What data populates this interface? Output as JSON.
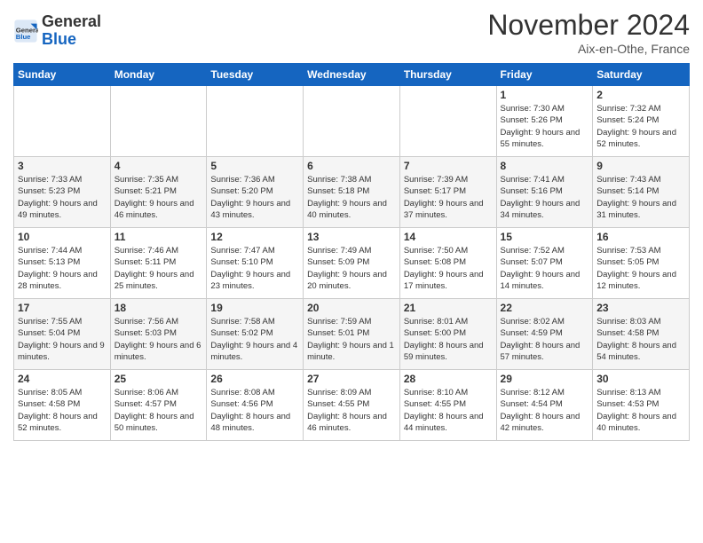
{
  "header": {
    "logo_text_general": "General",
    "logo_text_blue": "Blue",
    "month_title": "November 2024",
    "location": "Aix-en-Othe, France"
  },
  "calendar": {
    "days_of_week": [
      "Sunday",
      "Monday",
      "Tuesday",
      "Wednesday",
      "Thursday",
      "Friday",
      "Saturday"
    ],
    "weeks": [
      [
        {
          "day": "",
          "info": ""
        },
        {
          "day": "",
          "info": ""
        },
        {
          "day": "",
          "info": ""
        },
        {
          "day": "",
          "info": ""
        },
        {
          "day": "",
          "info": ""
        },
        {
          "day": "1",
          "info": "Sunrise: 7:30 AM\nSunset: 5:26 PM\nDaylight: 9 hours and 55 minutes."
        },
        {
          "day": "2",
          "info": "Sunrise: 7:32 AM\nSunset: 5:24 PM\nDaylight: 9 hours and 52 minutes."
        }
      ],
      [
        {
          "day": "3",
          "info": "Sunrise: 7:33 AM\nSunset: 5:23 PM\nDaylight: 9 hours and 49 minutes."
        },
        {
          "day": "4",
          "info": "Sunrise: 7:35 AM\nSunset: 5:21 PM\nDaylight: 9 hours and 46 minutes."
        },
        {
          "day": "5",
          "info": "Sunrise: 7:36 AM\nSunset: 5:20 PM\nDaylight: 9 hours and 43 minutes."
        },
        {
          "day": "6",
          "info": "Sunrise: 7:38 AM\nSunset: 5:18 PM\nDaylight: 9 hours and 40 minutes."
        },
        {
          "day": "7",
          "info": "Sunrise: 7:39 AM\nSunset: 5:17 PM\nDaylight: 9 hours and 37 minutes."
        },
        {
          "day": "8",
          "info": "Sunrise: 7:41 AM\nSunset: 5:16 PM\nDaylight: 9 hours and 34 minutes."
        },
        {
          "day": "9",
          "info": "Sunrise: 7:43 AM\nSunset: 5:14 PM\nDaylight: 9 hours and 31 minutes."
        }
      ],
      [
        {
          "day": "10",
          "info": "Sunrise: 7:44 AM\nSunset: 5:13 PM\nDaylight: 9 hours and 28 minutes."
        },
        {
          "day": "11",
          "info": "Sunrise: 7:46 AM\nSunset: 5:11 PM\nDaylight: 9 hours and 25 minutes."
        },
        {
          "day": "12",
          "info": "Sunrise: 7:47 AM\nSunset: 5:10 PM\nDaylight: 9 hours and 23 minutes."
        },
        {
          "day": "13",
          "info": "Sunrise: 7:49 AM\nSunset: 5:09 PM\nDaylight: 9 hours and 20 minutes."
        },
        {
          "day": "14",
          "info": "Sunrise: 7:50 AM\nSunset: 5:08 PM\nDaylight: 9 hours and 17 minutes."
        },
        {
          "day": "15",
          "info": "Sunrise: 7:52 AM\nSunset: 5:07 PM\nDaylight: 9 hours and 14 minutes."
        },
        {
          "day": "16",
          "info": "Sunrise: 7:53 AM\nSunset: 5:05 PM\nDaylight: 9 hours and 12 minutes."
        }
      ],
      [
        {
          "day": "17",
          "info": "Sunrise: 7:55 AM\nSunset: 5:04 PM\nDaylight: 9 hours and 9 minutes."
        },
        {
          "day": "18",
          "info": "Sunrise: 7:56 AM\nSunset: 5:03 PM\nDaylight: 9 hours and 6 minutes."
        },
        {
          "day": "19",
          "info": "Sunrise: 7:58 AM\nSunset: 5:02 PM\nDaylight: 9 hours and 4 minutes."
        },
        {
          "day": "20",
          "info": "Sunrise: 7:59 AM\nSunset: 5:01 PM\nDaylight: 9 hours and 1 minute."
        },
        {
          "day": "21",
          "info": "Sunrise: 8:01 AM\nSunset: 5:00 PM\nDaylight: 8 hours and 59 minutes."
        },
        {
          "day": "22",
          "info": "Sunrise: 8:02 AM\nSunset: 4:59 PM\nDaylight: 8 hours and 57 minutes."
        },
        {
          "day": "23",
          "info": "Sunrise: 8:03 AM\nSunset: 4:58 PM\nDaylight: 8 hours and 54 minutes."
        }
      ],
      [
        {
          "day": "24",
          "info": "Sunrise: 8:05 AM\nSunset: 4:58 PM\nDaylight: 8 hours and 52 minutes."
        },
        {
          "day": "25",
          "info": "Sunrise: 8:06 AM\nSunset: 4:57 PM\nDaylight: 8 hours and 50 minutes."
        },
        {
          "day": "26",
          "info": "Sunrise: 8:08 AM\nSunset: 4:56 PM\nDaylight: 8 hours and 48 minutes."
        },
        {
          "day": "27",
          "info": "Sunrise: 8:09 AM\nSunset: 4:55 PM\nDaylight: 8 hours and 46 minutes."
        },
        {
          "day": "28",
          "info": "Sunrise: 8:10 AM\nSunset: 4:55 PM\nDaylight: 8 hours and 44 minutes."
        },
        {
          "day": "29",
          "info": "Sunrise: 8:12 AM\nSunset: 4:54 PM\nDaylight: 8 hours and 42 minutes."
        },
        {
          "day": "30",
          "info": "Sunrise: 8:13 AM\nSunset: 4:53 PM\nDaylight: 8 hours and 40 minutes."
        }
      ]
    ]
  }
}
